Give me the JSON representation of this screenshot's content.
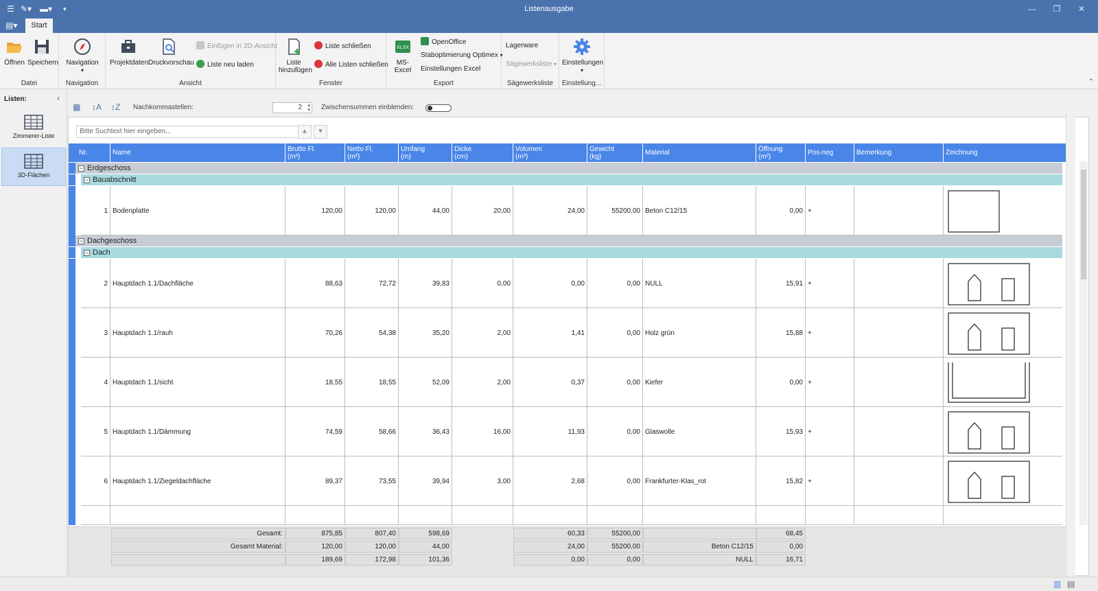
{
  "window": {
    "title": "Listenausgabe"
  },
  "tabs": [
    {
      "label": "Start"
    }
  ],
  "ribbon": {
    "groups": {
      "datei": "Datei",
      "navigation": "Navigation",
      "ansicht": "Ansicht",
      "fenster": "Fenster",
      "export": "Export",
      "saegewerksliste": "Sägewerksliste",
      "einstellung": "Einstellung..."
    },
    "buttons": {
      "oeffnen": "Öffnen",
      "speichern": "Speichern",
      "navigation": "Navigation",
      "projektdaten": "Projektdaten",
      "druckvorschau": "Druckvorschau",
      "einfuegen_2d": "Einfügen in 2D-Ansicht",
      "liste_neu_laden": "Liste neu laden",
      "liste_hinzufuegen_1": "Liste",
      "liste_hinzufuegen_2": "hinzufügen",
      "liste_schliessen": "Liste schließen",
      "alle_listen_schliessen": "Alle Listen schließen",
      "ms_excel": "MS-Excel",
      "xlsx": "XLSX",
      "openoffice": "OpenOffice",
      "staboptimierung": "Staboptimierung Optimex",
      "einstellungen_excel": "Einstellungen Excel",
      "lagerware": "Lagerware",
      "saegewerksliste": "Sägewerksliste",
      "einstellungen": "Einstellungen"
    }
  },
  "left_panel": {
    "header": "Listen:",
    "items": [
      {
        "label": "Zimmerer-Liste",
        "active": false
      },
      {
        "label": "3D-Flächen",
        "active": true
      }
    ]
  },
  "list_toolbar": {
    "nachkommastellen_label": "Nachkommastellen:",
    "nachkommastellen_value": "2",
    "zwischensummen_label": "Zwischensummen einblenden:",
    "zwischensummen_on": false
  },
  "search": {
    "placeholder": "Bitte Suchtext hier eingeben..."
  },
  "columns": [
    {
      "l1": "Nr.",
      "l2": ""
    },
    {
      "l1": "Name",
      "l2": ""
    },
    {
      "l1": "Brutto Fl.",
      "l2": "(m²)"
    },
    {
      "l1": "Netto Fl.",
      "l2": "(m²)"
    },
    {
      "l1": "Umfang",
      "l2": "(m)"
    },
    {
      "l1": "Dicke",
      "l2": "(cm)"
    },
    {
      "l1": "Volumen",
      "l2": "(m³)"
    },
    {
      "l1": "Gewicht",
      "l2": "(kg)"
    },
    {
      "l1": "Material",
      "l2": ""
    },
    {
      "l1": "Öffnung",
      "l2": "(m²)"
    },
    {
      "l1": "Pos-neg",
      "l2": ""
    },
    {
      "l1": "Bemerkung",
      "l2": ""
    },
    {
      "l1": "Zeichnung",
      "l2": ""
    }
  ],
  "groups": [
    {
      "name": "Erdgeschoss",
      "subgroups": [
        {
          "name": "Bauabschnitt",
          "rows": [
            {
              "nr": "1",
              "name": "Bodenplatte",
              "brutto": "120,00",
              "netto": "120,00",
              "umfang": "44,00",
              "dicke": "20,00",
              "volumen": "24,00",
              "gewicht": "55200,00",
              "material": "Beton C12/15",
              "oeffnung": "0,00",
              "posneg": "+",
              "bemerkung": "",
              "drawing": "plain"
            }
          ]
        }
      ]
    },
    {
      "name": "Dachgeschoss",
      "subgroups": [
        {
          "name": "Dach",
          "rows": [
            {
              "nr": "2",
              "name": "Hauptdach 1.1/Dachfläche",
              "brutto": "88,63",
              "netto": "72,72",
              "umfang": "39,83",
              "dicke": "0,00",
              "volumen": "0,00",
              "gewicht": "0,00",
              "material": "NULL",
              "oeffnung": "15,91",
              "posneg": "+",
              "bemerkung": "",
              "drawing": "house"
            },
            {
              "nr": "3",
              "name": "Hauptdach 1.1/rauh",
              "brutto": "70,26",
              "netto": "54,38",
              "umfang": "35,20",
              "dicke": "2,00",
              "volumen": "1,41",
              "gewicht": "0,00",
              "material": "Holz grün",
              "oeffnung": "15,88",
              "posneg": "+",
              "bemerkung": "",
              "drawing": "house"
            },
            {
              "nr": "4",
              "name": "Hauptdach 1.1/sicht",
              "brutto": "18,55",
              "netto": "18,55",
              "umfang": "52,09",
              "dicke": "2,00",
              "volumen": "0,37",
              "gewicht": "0,00",
              "material": "Kiefer",
              "oeffnung": "0,00",
              "posneg": "+",
              "bemerkung": "",
              "drawing": "ushape"
            },
            {
              "nr": "5",
              "name": "Hauptdach 1.1/Dämmung",
              "brutto": "74,59",
              "netto": "58,66",
              "umfang": "36,43",
              "dicke": "16,00",
              "volumen": "11,93",
              "gewicht": "0,00",
              "material": "Glaswolle",
              "oeffnung": "15,93",
              "posneg": "+",
              "bemerkung": "",
              "drawing": "house"
            },
            {
              "nr": "6",
              "name": "Hauptdach 1.1/Ziegeldachfläche",
              "brutto": "89,37",
              "netto": "73,55",
              "umfang": "39,94",
              "dicke": "3,00",
              "volumen": "2,68",
              "gewicht": "0,00",
              "material": "Frankfurter-Klas_rot",
              "oeffnung": "15,82",
              "posneg": "+",
              "bemerkung": "",
              "drawing": "house"
            }
          ]
        }
      ]
    }
  ],
  "summary": [
    {
      "label": "Gesamt:",
      "brutto": "875,85",
      "netto": "807,40",
      "umfang": "598,69",
      "volumen": "60,33",
      "gewicht": "55200,00",
      "material": "",
      "oeffnung": "68,45"
    },
    {
      "label": "Gesamt Material:",
      "brutto": "120,00",
      "netto": "120,00",
      "umfang": "44,00",
      "volumen": "24,00",
      "gewicht": "55200,00",
      "material": "Beton C12/15",
      "oeffnung": "0,00"
    },
    {
      "label": "",
      "brutto": "189,69",
      "netto": "172,98",
      "umfang": "101,36",
      "volumen": "0,00",
      "gewicht": "0,00",
      "material": "NULL",
      "oeffnung": "16,71"
    }
  ],
  "colors": {
    "titlebar": "#4a72ad",
    "header": "#4a86e8",
    "group1": "#c8ccd4",
    "group2": "#a8dbe0"
  }
}
